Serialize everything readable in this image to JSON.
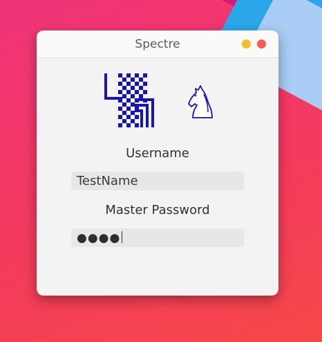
{
  "window": {
    "title": "Spectre",
    "controls": [
      "minimize",
      "close"
    ]
  },
  "logo": {
    "icons": [
      "chessboard-mark",
      "chess-knight"
    ]
  },
  "form": {
    "username_label": "Username",
    "username_value": "TestName",
    "password_label": "Master Password",
    "password_value_masked": "●●●●"
  },
  "colors": {
    "logo_blue": "#1414b8",
    "minimize": "#f6be22",
    "close": "#f65b50"
  }
}
